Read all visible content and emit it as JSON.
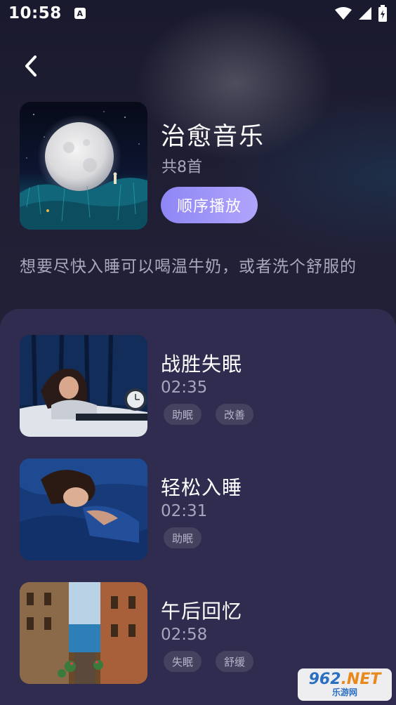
{
  "status_bar": {
    "time": "10:58",
    "notification_icon": "A"
  },
  "header": {
    "title": "治愈音乐",
    "count": "共8首",
    "play_button": "顺序播放",
    "description": "想要尽快入睡可以喝温牛奶，或者洗个舒服的"
  },
  "tracks": [
    {
      "title": "战胜失眠",
      "duration": "02:35",
      "tags": [
        "助眠",
        "改善"
      ]
    },
    {
      "title": "轻松入睡",
      "duration": "02:31",
      "tags": [
        "助眠"
      ]
    },
    {
      "title": "午后回忆",
      "duration": "02:58",
      "tags": [
        "失眠",
        "舒缓"
      ]
    }
  ],
  "watermark": {
    "brand_a": "962",
    "brand_b": ".NET",
    "sub": "乐游网"
  },
  "colors": {
    "accent_start": "#8e86f5",
    "accent_end": "#b0a5fb",
    "panel": "#2f2c4f",
    "background": "#1f1d35"
  }
}
